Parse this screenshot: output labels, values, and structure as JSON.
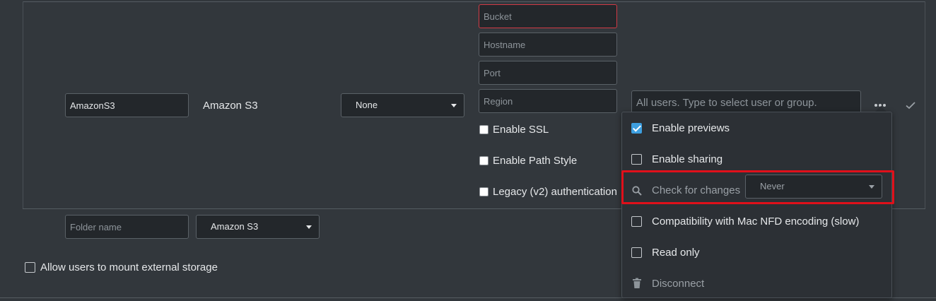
{
  "mount_row": {
    "folder_name_value": "AmazonS3",
    "backend_label": "Amazon S3",
    "auth_select_value": "None",
    "bucket_placeholder": "Bucket",
    "hostname_placeholder": "Hostname",
    "port_placeholder": "Port",
    "region_placeholder": "Region",
    "enable_ssl_label": "Enable SSL",
    "enable_path_style_label": "Enable Path Style",
    "legacy_auth_label": "Legacy (v2) authentication",
    "users_placeholder": "All users. Type to select user or group."
  },
  "new_row": {
    "folder_name_placeholder": "Folder name",
    "backend_select_value": "Amazon S3"
  },
  "allow_mount_label": "Allow users to mount external storage",
  "options_menu": {
    "enable_previews_label": "Enable previews",
    "enable_sharing_label": "Enable sharing",
    "check_for_changes_label": "Check for changes",
    "check_for_changes_value": "Never",
    "mac_nfd_label": "Compatibility with Mac NFD encoding (slow)",
    "read_only_label": "Read only",
    "disconnect_label": "Disconnect"
  },
  "colors": {
    "background": "#32373c",
    "accent": "#3d9fe0",
    "highlight": "#e0101a",
    "error_border": "#d13a45"
  }
}
